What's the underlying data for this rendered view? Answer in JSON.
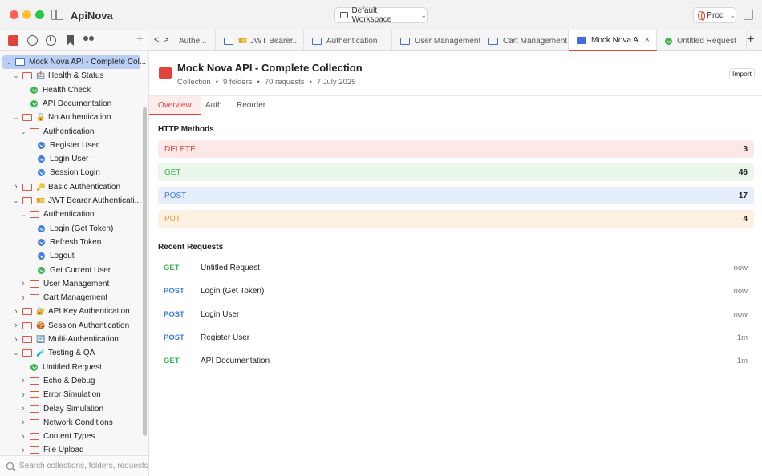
{
  "app": {
    "title": "ApiNova"
  },
  "workspace": {
    "label": "Default Workspace"
  },
  "environment": {
    "label": "Prod"
  },
  "tabs": [
    {
      "label": "Authe...",
      "icon": "none"
    },
    {
      "label": "JWT Bearer...",
      "icon": "emoji-badge"
    },
    {
      "label": "Authentication",
      "icon": "folder"
    },
    {
      "label": "User Management",
      "icon": "folder"
    },
    {
      "label": "Cart Management",
      "icon": "folder"
    },
    {
      "label": "Mock Nova A...",
      "icon": "folder",
      "active": true
    },
    {
      "label": "Untitled Request",
      "icon": "get"
    }
  ],
  "tree": [
    {
      "depth": 0,
      "caret": "open",
      "icon": "folder-blue",
      "label": "Mock Nova API - Complete Col...",
      "selected": true
    },
    {
      "depth": 1,
      "caret": "open",
      "icon": "folder",
      "emoji": "🏥",
      "label": "Health & Status"
    },
    {
      "depth": 2,
      "caret": "",
      "icon": "get",
      "label": "Health Check"
    },
    {
      "depth": 2,
      "caret": "",
      "icon": "get",
      "label": "API Documentation"
    },
    {
      "depth": 1,
      "caret": "open",
      "icon": "folder",
      "emoji": "🔓",
      "label": "No Authentication"
    },
    {
      "depth": 2,
      "caret": "open",
      "icon": "folder",
      "label": "Authentication"
    },
    {
      "depth": 3,
      "caret": "",
      "icon": "post",
      "label": "Register User"
    },
    {
      "depth": 3,
      "caret": "",
      "icon": "post",
      "label": "Login User"
    },
    {
      "depth": 3,
      "caret": "",
      "icon": "post",
      "label": "Session Login"
    },
    {
      "depth": 1,
      "caret": "closed",
      "icon": "folder",
      "emoji": "🔑",
      "label": "Basic Authentication"
    },
    {
      "depth": 1,
      "caret": "open",
      "icon": "folder",
      "emoji": "🎫",
      "label": "JWT Bearer Authenticati..."
    },
    {
      "depth": 2,
      "caret": "open",
      "icon": "folder",
      "label": "Authentication"
    },
    {
      "depth": 3,
      "caret": "",
      "icon": "post",
      "label": "Login (Get Token)"
    },
    {
      "depth": 3,
      "caret": "",
      "icon": "post",
      "label": "Refresh Token"
    },
    {
      "depth": 3,
      "caret": "",
      "icon": "post",
      "label": "Logout"
    },
    {
      "depth": 3,
      "caret": "",
      "icon": "get",
      "label": "Get Current User"
    },
    {
      "depth": 2,
      "caret": "closed",
      "icon": "folder",
      "label": "User Management"
    },
    {
      "depth": 2,
      "caret": "closed",
      "icon": "folder",
      "label": "Cart Management"
    },
    {
      "depth": 1,
      "caret": "closed",
      "icon": "folder",
      "emoji": "🔐",
      "label": "API Key Authentication"
    },
    {
      "depth": 1,
      "caret": "closed",
      "icon": "folder",
      "emoji": "🍪",
      "label": "Session Authentication"
    },
    {
      "depth": 1,
      "caret": "closed",
      "icon": "folder",
      "emoji": "🔄",
      "label": "Multi-Authentication"
    },
    {
      "depth": 1,
      "caret": "open",
      "icon": "folder",
      "emoji": "🧪",
      "label": "Testing & QA"
    },
    {
      "depth": 2,
      "caret": "",
      "icon": "get",
      "label": "Untitled Request"
    },
    {
      "depth": 2,
      "caret": "closed",
      "icon": "folder",
      "label": "Echo & Debug"
    },
    {
      "depth": 2,
      "caret": "closed",
      "icon": "folder",
      "label": "Error Simulation"
    },
    {
      "depth": 2,
      "caret": "closed",
      "icon": "folder",
      "label": "Delay Simulation"
    },
    {
      "depth": 2,
      "caret": "closed",
      "icon": "folder",
      "label": "Network Conditions"
    },
    {
      "depth": 2,
      "caret": "closed",
      "icon": "folder",
      "label": "Content Types"
    },
    {
      "depth": 2,
      "caret": "closed",
      "icon": "folder",
      "label": "File Upload"
    }
  ],
  "search": {
    "placeholder": "Search collections, folders, requests..."
  },
  "collection": {
    "title": "Mock Nova API - Complete Collection",
    "type": "Collection",
    "folders": "9 folders",
    "requests": "70 requests",
    "date": "7 July 2025",
    "separator": "•",
    "import_label": "Import"
  },
  "subtabs": [
    "Overview",
    "Auth",
    "Reorder"
  ],
  "http_methods": {
    "title": "HTTP Methods",
    "items": [
      {
        "method": "DELETE",
        "count": "3",
        "color": "#e0443a",
        "bg": "#fde7e7"
      },
      {
        "method": "GET",
        "count": "46",
        "color": "#3bb54a",
        "bg": "#e9f6e9"
      },
      {
        "method": "POST",
        "count": "17",
        "color": "#3d7be3",
        "bg": "#e6eefc"
      },
      {
        "method": "PUT",
        "count": "4",
        "color": "#e8922a",
        "bg": "#fdf1e4"
      }
    ]
  },
  "recent": {
    "title": "Recent Requests",
    "items": [
      {
        "method": "GET",
        "name": "Untitled Request",
        "time": "now",
        "color": "#3bb54a"
      },
      {
        "method": "POST",
        "name": "Login (Get Token)",
        "time": "now",
        "color": "#3d7be3"
      },
      {
        "method": "POST",
        "name": "Login User",
        "time": "now",
        "color": "#3d7be3"
      },
      {
        "method": "POST",
        "name": "Register User",
        "time": "1m",
        "color": "#3d7be3"
      },
      {
        "method": "GET",
        "name": "API Documentation",
        "time": "1m",
        "color": "#3bb54a"
      }
    ]
  }
}
